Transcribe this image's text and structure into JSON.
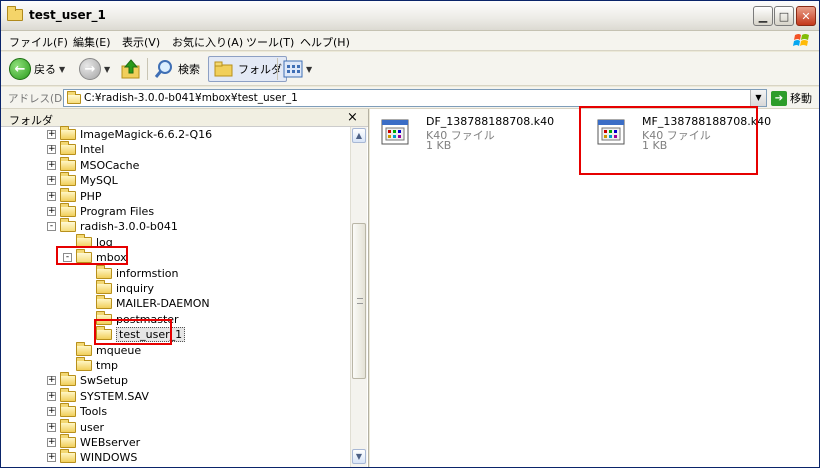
{
  "window": {
    "title": "test_user_1"
  },
  "menu": {
    "items": [
      "ファイル(F)",
      "編集(E)",
      "表示(V)",
      "お気に入り(A)",
      "ツール(T)",
      "ヘルプ(H)"
    ]
  },
  "toolbar": {
    "back_label": "戻る",
    "search_label": "検索",
    "folders_label": "フォルダ"
  },
  "address": {
    "label": "アドレス(D)",
    "value": "C:¥radish-3.0.0-b041¥mbox¥test_user_1",
    "go_label": "移動"
  },
  "folder_pane": {
    "title": "フォルダ",
    "close_glyph": "×",
    "tree": [
      {
        "label": "ImageMagick-6.6.2-Q16",
        "level": 0,
        "expander": "+"
      },
      {
        "label": "Intel",
        "level": 0,
        "expander": "+"
      },
      {
        "label": "MSOCache",
        "level": 0,
        "expander": "+"
      },
      {
        "label": "MySQL",
        "level": 0,
        "expander": "+"
      },
      {
        "label": "PHP",
        "level": 0,
        "expander": "+"
      },
      {
        "label": "Program Files",
        "level": 0,
        "expander": "+"
      },
      {
        "label": "radish-3.0.0-b041",
        "level": 0,
        "expander": "-"
      },
      {
        "label": "log",
        "level": 1,
        "expander": ""
      },
      {
        "label": "mbox",
        "level": 1,
        "expander": "-"
      },
      {
        "label": "informstion",
        "level": 2,
        "expander": ""
      },
      {
        "label": "inquiry",
        "level": 2,
        "expander": ""
      },
      {
        "label": "MAILER-DAEMON",
        "level": 2,
        "expander": ""
      },
      {
        "label": "postmaster",
        "level": 2,
        "expander": ""
      },
      {
        "label": "test_user_1",
        "level": 2,
        "expander": "",
        "selected": true
      },
      {
        "label": "mqueue",
        "level": 1,
        "expander": ""
      },
      {
        "label": "tmp",
        "level": 1,
        "expander": ""
      },
      {
        "label": "SwSetup",
        "level": 0,
        "expander": "+"
      },
      {
        "label": "SYSTEM.SAV",
        "level": 0,
        "expander": "+"
      },
      {
        "label": "Tools",
        "level": 0,
        "expander": "+"
      },
      {
        "label": "user",
        "level": 0,
        "expander": "+"
      },
      {
        "label": "WEBserver",
        "level": 0,
        "expander": "+"
      },
      {
        "label": "WINDOWS",
        "level": 0,
        "expander": "+"
      }
    ]
  },
  "files": [
    {
      "name": "DF_138788188708.k40",
      "type": "K40 ファイル",
      "size": "1 KB"
    },
    {
      "name": "MF_138788188708.k40",
      "type": "K40 ファイル",
      "size": "1 KB"
    }
  ],
  "colors": {
    "highlight": "#e60000",
    "title_bg": "#ecebe6",
    "folder": "#f1cf5b"
  }
}
